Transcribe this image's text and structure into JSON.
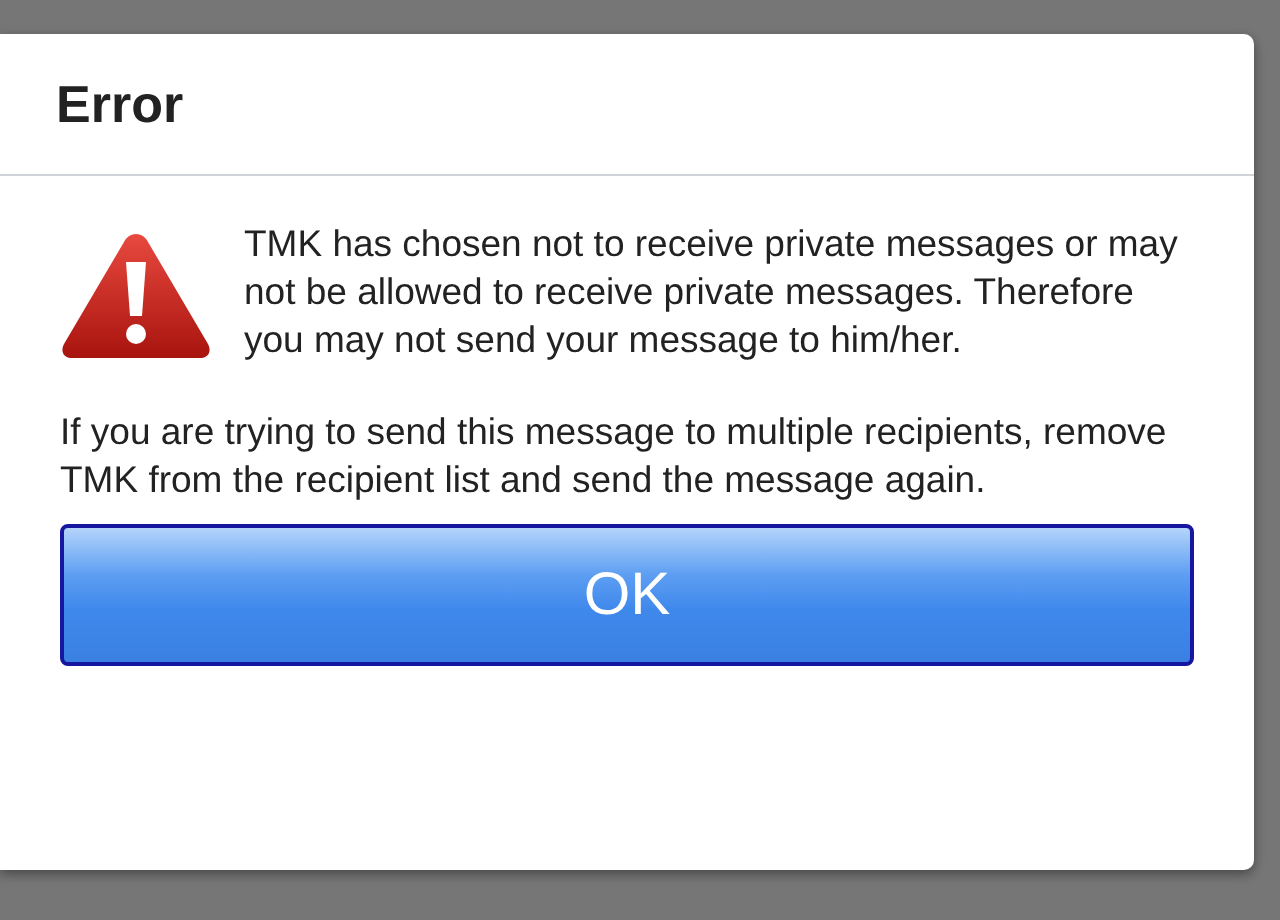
{
  "dialog": {
    "title": "Error",
    "message": "TMK has chosen not to receive private messages or may not be allowed to receive private messages. Therefore you may not send your message to him/her.",
    "hint": "If you are trying to send this message to multiple recipients, remove TMK from the recipient list and send the message again.",
    "buttons": [
      "OK"
    ]
  }
}
